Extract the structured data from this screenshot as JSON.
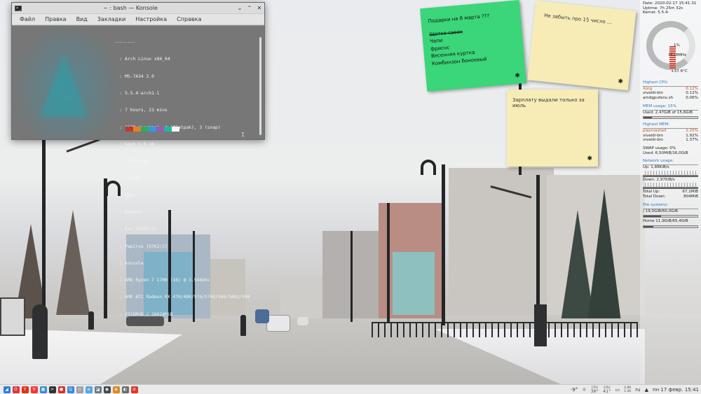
{
  "konsole": {
    "title": "~ : bash — Konsole",
    "menu": [
      "Файл",
      "Правка",
      "Вид",
      "Закладки",
      "Настройка",
      "Справка"
    ],
    "info_lines": [
      "--------",
      "  : Arch Linux x86_64",
      "  : MS-7A34 2.0",
      "  : 5.5.4-arch1-1",
      "  : 7 hours, 23 mins",
      "  : 1679 (pacman), 4 (flatpak), 3 (snap)",
      "  : bash 5.0.16",
      "  : 1920x1080",
      "  : Plasma",
      "  : KWin",
      "  : Breeze",
      "  : Arc [GTK2/3]",
      "  : Papirus [GTK2/3]",
      "  : konsole",
      "  : AMD Ryzen 7 1700 (16) @ 3.548GHz",
      "  : AMD ATI Radeon RX 470/480/570/570X/580/580X/590",
      "  : 2515MiB / 16024MiB"
    ],
    "palette": [
      "#c0392b",
      "#e67e22",
      "#27ae60",
      "#3498db",
      "#9b59b6",
      "#1abc9c",
      "#f4f4f4"
    ],
    "cursor_glyph": "I"
  },
  "notes": {
    "green": {
      "title": "Подарки на 8 марта ???",
      "items": [
        "Щетко-савок",
        "Чапи",
        "фриснс",
        "Весенняя куртка",
        "Комбинзон боноевый"
      ]
    },
    "yellow1": {
      "text": "Не забыть про 15 число ..."
    },
    "yellow2": {
      "text": "Зарплату выдали только за июль"
    },
    "gear_glyph": "✱"
  },
  "conky": {
    "date": "Date: 2020-02-17 15:41:31",
    "uptime": "Uptime: 7h 25m 32s",
    "kernel": "Kernel: 5.5.4-",
    "cpu_percent": "1%",
    "cpu_freq": "3614MHz",
    "cpu_temp": "+37.6°C",
    "highest_cpu_title": "Highest CPU:",
    "highest_cpu": [
      {
        "name": "Xorg",
        "value": "0.12%"
      },
      {
        "name": "vivaldi-bin",
        "value": "0.12%"
      },
      {
        "name": "amdgpufans.sh",
        "value": "0.06%"
      }
    ],
    "mem_title": "MEM usage: 15%",
    "mem_used": "Used: 2,47GiB of 15,6GiB",
    "mem_fraction": 0.15,
    "highest_mem_title": "Highest MEM:",
    "highest_mem": [
      {
        "name": "plasmashell",
        "value": "2.25%"
      },
      {
        "name": "vivaldi-bin",
        "value": "1.92%"
      },
      {
        "name": "vivaldi-bin",
        "value": "1.37%"
      }
    ],
    "swap": "SWAP usage: 0%",
    "swap_used": "Used: 6,50MiB/16,0GiB",
    "net_title": "Network usage:",
    "up": "Up: 1,88KiB/s",
    "down": "Down: 2,97KiB/s",
    "total_up_label": "Total Up:",
    "total_up": "67,1MiB",
    "total_down_label": "Total Down:",
    "total_down": "804MiB",
    "fs_title": "File systems:",
    "fs_root": "/ 19,0GiB/60,0GiB",
    "fs_root_fraction": 0.32,
    "fs_home": "Home 11,9GiB/65,4GiB",
    "fs_home_fraction": 0.18
  },
  "taskbar": {
    "launchers": [
      {
        "name": "app-launcher-icon",
        "glyph": "◢",
        "color": "#2a7fd4"
      },
      {
        "name": "opera-icon",
        "glyph": "O",
        "color": "#d9363e"
      },
      {
        "name": "yandex-icon",
        "glyph": "Y",
        "color": "#e1301f"
      },
      {
        "name": "vivaldi-icon",
        "glyph": "V",
        "color": "#ef3939"
      },
      {
        "name": "files-icon",
        "glyph": "▦",
        "color": "#3a8bd4"
      },
      {
        "name": "konsole-icon",
        "glyph": ">",
        "color": "#333333"
      },
      {
        "name": "record-icon",
        "glyph": "●",
        "color": "#d0342c"
      },
      {
        "name": "torrent-icon",
        "glyph": "Q",
        "color": "#3d88d6"
      },
      {
        "name": "document-icon",
        "glyph": "▯",
        "color": "#9aa1a8"
      },
      {
        "name": "text-editor-icon",
        "glyph": "≡",
        "color": "#53a6e0"
      },
      {
        "name": "image-viewer-icon",
        "glyph": "◪",
        "color": "#6b7b86"
      },
      {
        "name": "steam-icon",
        "glyph": "◉",
        "color": "#434a52"
      },
      {
        "name": "game-icon",
        "glyph": "◈",
        "color": "#d88a2a"
      },
      {
        "name": "media-icon",
        "glyph": "◐",
        "color": "#6d6d6d"
      },
      {
        "name": "antivirus-icon",
        "glyph": "⊘",
        "color": "#d73a31"
      }
    ],
    "temperature": "-9°",
    "weather_icon": "☼",
    "cpu_temp_label": "CPU",
    "cpu_temp_value": "38°",
    "gpu_temp_label": "GPU",
    "gpu_temp_value": "41°",
    "net_down_small": "4,8K",
    "net_up_small": "1,4K",
    "language": "ru",
    "datetime": "пн 17 февр. 15:41"
  }
}
